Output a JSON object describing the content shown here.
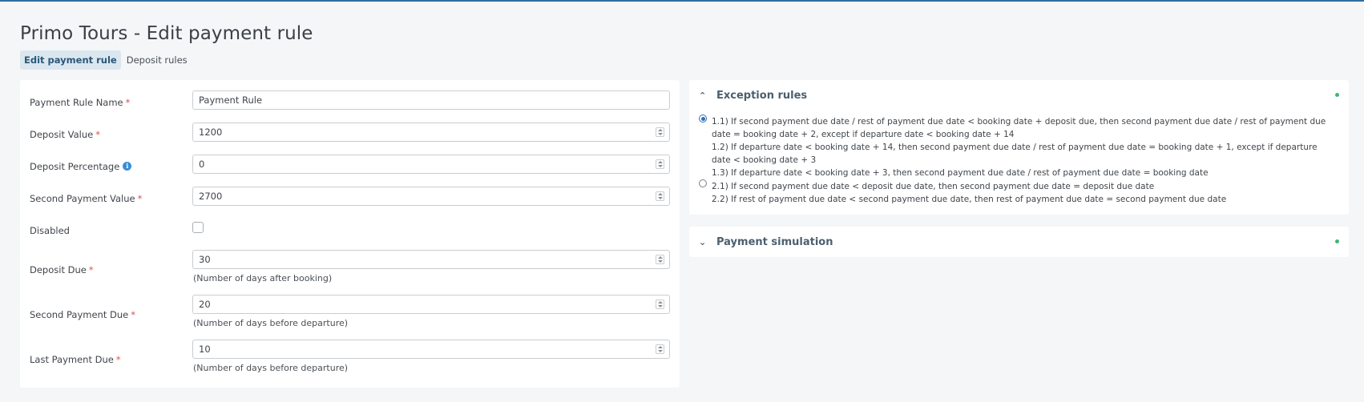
{
  "page_title": "Primo Tours - Edit payment rule",
  "tabs": [
    {
      "label": "Edit payment rule",
      "active": true
    },
    {
      "label": "Deposit rules",
      "active": false
    }
  ],
  "form": {
    "name": {
      "label": "Payment Rule Name",
      "required": "*",
      "value": "Payment Rule"
    },
    "deposit_value": {
      "label": "Deposit Value",
      "required": "*",
      "value": "1200"
    },
    "deposit_percentage": {
      "label": "Deposit Percentage",
      "value": "0",
      "icon": "info-icon"
    },
    "second_payment_value": {
      "label": "Second Payment Value",
      "required": "*",
      "value": "2700"
    },
    "disabled": {
      "label": "Disabled",
      "checked": false
    },
    "deposit_due": {
      "label": "Deposit Due",
      "required": "*",
      "value": "30",
      "hint": "(Number of days after booking)"
    },
    "second_payment_due": {
      "label": "Second Payment Due",
      "required": "*",
      "value": "20",
      "hint": "(Number of days before departure)"
    },
    "last_payment_due": {
      "label": "Last Payment Due",
      "required": "*",
      "value": "10",
      "hint": "(Number of days before departure)"
    }
  },
  "exception_rules": {
    "title": "Exception rules",
    "expanded": true,
    "status_color": "#3bb873",
    "options": [
      {
        "selected": true,
        "lines": [
          "1.1) If second payment due date / rest of payment due date < booking date + deposit due, then second payment due date / rest of payment due date = booking date + 2, except if departure date < booking date + 14",
          "1.2) If departure date < booking date + 14, then second payment due date / rest of payment due date = booking date + 1, except if departure date < booking date + 3",
          "1.3) If departure date < booking date + 3, then second payment due date / rest of payment due date = booking date"
        ]
      },
      {
        "selected": false,
        "lines": [
          "2.1) If second payment due date < deposit due date, then second payment due date = deposit due date",
          "2.2) If rest of payment due date < second payment due date, then rest of payment due date = second payment due date"
        ]
      }
    ]
  },
  "payment_simulation": {
    "title": "Payment simulation",
    "expanded": false,
    "status_color": "#3bb873"
  }
}
